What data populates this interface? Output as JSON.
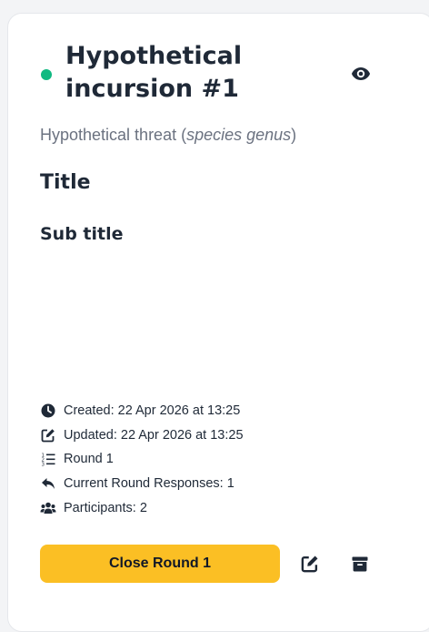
{
  "card": {
    "status_color": "#10b981",
    "title": "Hypothetical incursion #1",
    "subtitle_prefix": "Hypothetical threat (",
    "subtitle_species": "species genus",
    "subtitle_suffix": ")",
    "heading": "Title",
    "subheading": "Sub title",
    "view_icon": "eye-icon"
  },
  "meta": {
    "created": "Created: 22 Apr 2026 at 13:25",
    "updated": "Updated: 22 Apr 2026 at 13:25",
    "round": "Round 1",
    "responses": "Current Round Responses: 1",
    "participants": "Participants: 2",
    "icons": [
      "clock-icon",
      "edit-square-icon",
      "ordered-list-icon",
      "reply-icon",
      "users-icon"
    ]
  },
  "actions": {
    "primary_label": "Close Round 1",
    "primary_color": "#fbbf24",
    "edit_icon": "edit-square-icon",
    "archive_icon": "archive-icon"
  }
}
